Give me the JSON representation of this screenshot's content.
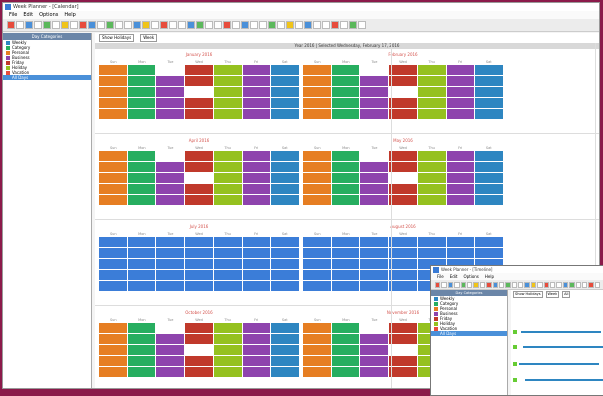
{
  "window": {
    "title": "Week Planner - [Calendar]",
    "menu": [
      "File",
      "Edit",
      "Options",
      "Help"
    ]
  },
  "sidebar": {
    "header": "Day Categories",
    "categories": [
      {
        "label": "Weekly",
        "color": "#2e86c1"
      },
      {
        "label": "Category",
        "color": "#27ae60"
      },
      {
        "label": "Personal",
        "color": "#e67e22"
      },
      {
        "label": "Business",
        "color": "#8e44ad"
      },
      {
        "label": "Friday",
        "color": "#c0392b"
      },
      {
        "label": "Holiday",
        "color": "#95c11f"
      },
      {
        "label": "Vacation",
        "color": "#e74c3c"
      },
      {
        "label": "All Days",
        "color": "#4a90d9",
        "selected": true
      }
    ]
  },
  "controls": {
    "show_holidays": "Show Holidays",
    "week": "Week",
    "date_label": "Year 2016 | Selected Wednesday, February 17, 2016"
  },
  "day_headers": [
    "Sun",
    "Mon",
    "Tue",
    "Wed",
    "Thu",
    "Fri",
    "Sat"
  ],
  "months": [
    {
      "name": "January 2016",
      "col": 0,
      "row": 0
    },
    {
      "name": "February 2016",
      "col": 1,
      "row": 0
    },
    {
      "name": "April 2016",
      "col": 0,
      "row": 1
    },
    {
      "name": "May 2016",
      "col": 1,
      "row": 1
    },
    {
      "name": "July 2016",
      "col": 0,
      "row": 2
    },
    {
      "name": "August 2016",
      "col": 1,
      "row": 2
    },
    {
      "name": "October 2016",
      "col": 0,
      "row": 3
    },
    {
      "name": "November 2016",
      "col": 1,
      "row": 3
    }
  ],
  "second_window": {
    "title": "Week Planner - [Timeline]",
    "sidebar_header": "Day Categories",
    "controls": [
      "Show Holidays",
      "Week",
      "All"
    ]
  }
}
